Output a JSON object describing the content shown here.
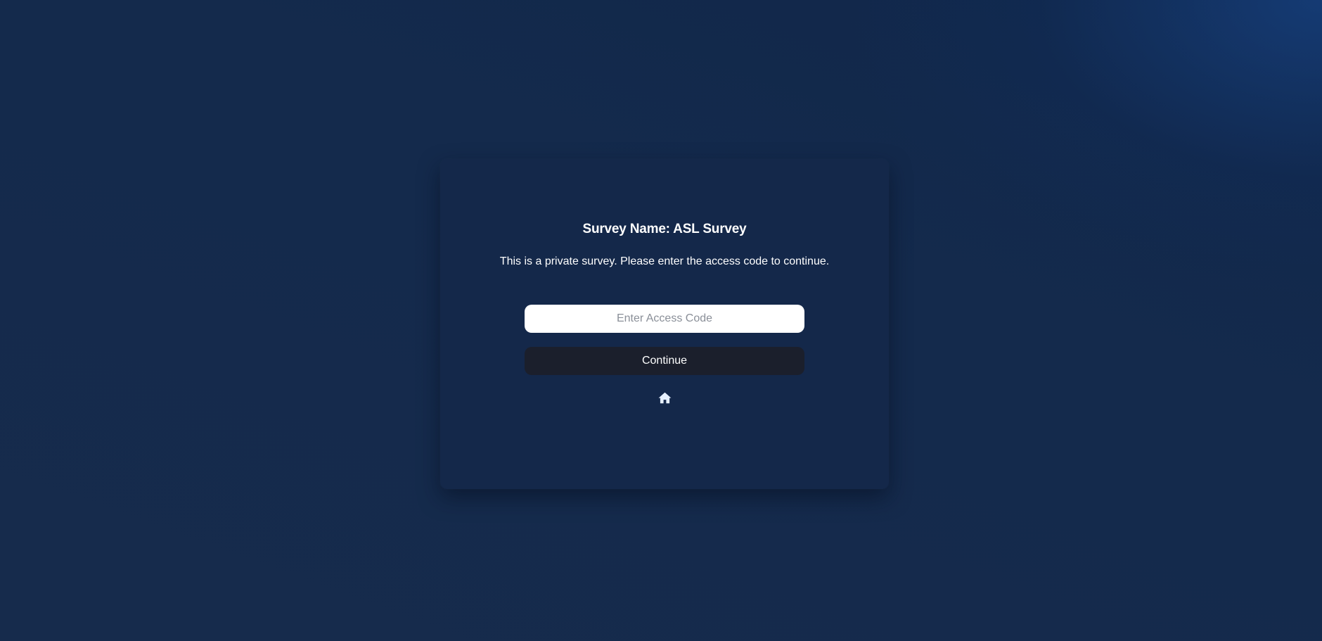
{
  "survey": {
    "title": "Survey Name: ASL Survey",
    "message": "This is a private survey. Please enter the access code to continue."
  },
  "access_code": {
    "value": "",
    "placeholder": "Enter Access Code"
  },
  "actions": {
    "continue_label": "Continue",
    "home_icon": "home-icon"
  },
  "colors": {
    "card_background": "#14284a",
    "button_background": "#1b1f2c",
    "input_background": "#ffffff",
    "home_icon": "#e6f0ff"
  }
}
